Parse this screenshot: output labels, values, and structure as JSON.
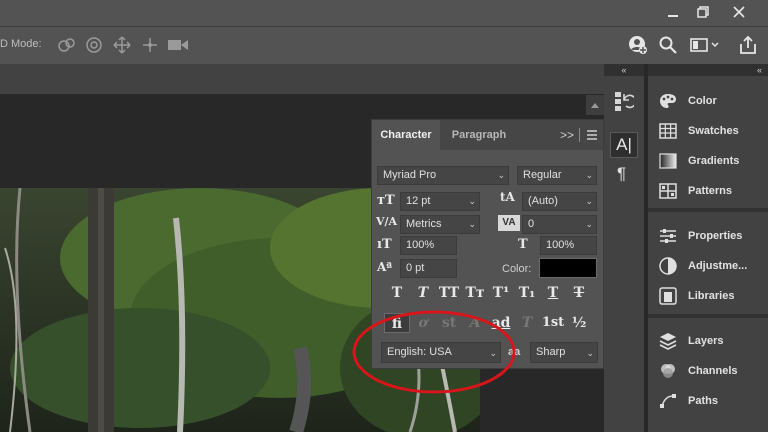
{
  "options_bar": {
    "mode_label": "D Mode:"
  },
  "character_panel": {
    "tab_character": "Character",
    "tab_paragraph": "Paragraph",
    "font_family": "Myriad Pro",
    "font_style": "Regular",
    "font_size": "12 pt",
    "leading": "(Auto)",
    "kerning": "Metrics",
    "tracking": "0",
    "vertical_scale": "100%",
    "horizontal_scale": "100%",
    "baseline_shift": "0 pt",
    "color_label": "Color:",
    "color_value": "#000000",
    "language": "English: USA",
    "antialias_label": "aa",
    "antialias": "Sharp",
    "glyphs_row1": [
      "T",
      "T",
      "TT",
      "Tт",
      "T¹",
      "T₁",
      "T",
      "T"
    ],
    "glyphs_row2": [
      "fi",
      "ơ",
      "st",
      "A",
      "ad",
      "T",
      "1st",
      "½"
    ]
  },
  "right_panel": {
    "group1": [
      {
        "label": "Color",
        "icon": "palette-icon"
      },
      {
        "label": "Swatches",
        "icon": "grid-icon"
      },
      {
        "label": "Gradients",
        "icon": "gradient-icon"
      },
      {
        "label": "Patterns",
        "icon": "pattern-icon"
      }
    ],
    "group2": [
      {
        "label": "Properties",
        "icon": "sliders-icon"
      },
      {
        "label": "Adjustme...",
        "icon": "adjustment-icon"
      },
      {
        "label": "Libraries",
        "icon": "libraries-icon"
      }
    ],
    "group3": [
      {
        "label": "Layers",
        "icon": "layers-icon"
      },
      {
        "label": "Channels",
        "icon": "channels-icon"
      },
      {
        "label": "Paths",
        "icon": "paths-icon"
      }
    ]
  },
  "colors": {
    "annotation": "#d7151a",
    "panel_bg": "#535353",
    "dark_bg": "#282828"
  }
}
